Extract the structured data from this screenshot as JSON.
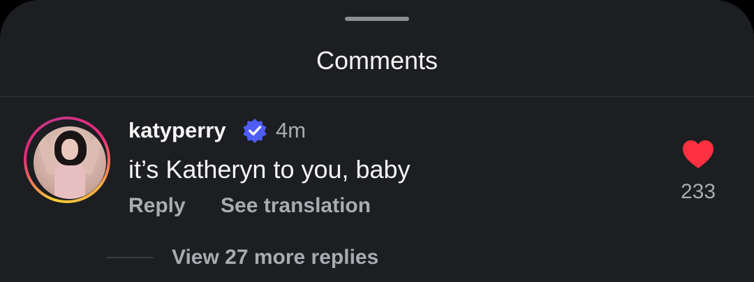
{
  "header": {
    "title": "Comments"
  },
  "comment": {
    "username": "katyperry",
    "verified": true,
    "time": "4m",
    "text": "it’s Katheryn to you, baby",
    "reply_label": "Reply",
    "translate_label": "See translation",
    "like_count": "233",
    "liked": true,
    "view_replies_label": "View 27 more replies"
  },
  "colors": {
    "background": "#1c1e21",
    "verified_badge": "#4d5df5",
    "like_heart": "#ff3040",
    "muted_text": "#a8abb0"
  },
  "icons": {
    "verified": "verified-badge-icon",
    "like": "heart-filled-icon"
  }
}
